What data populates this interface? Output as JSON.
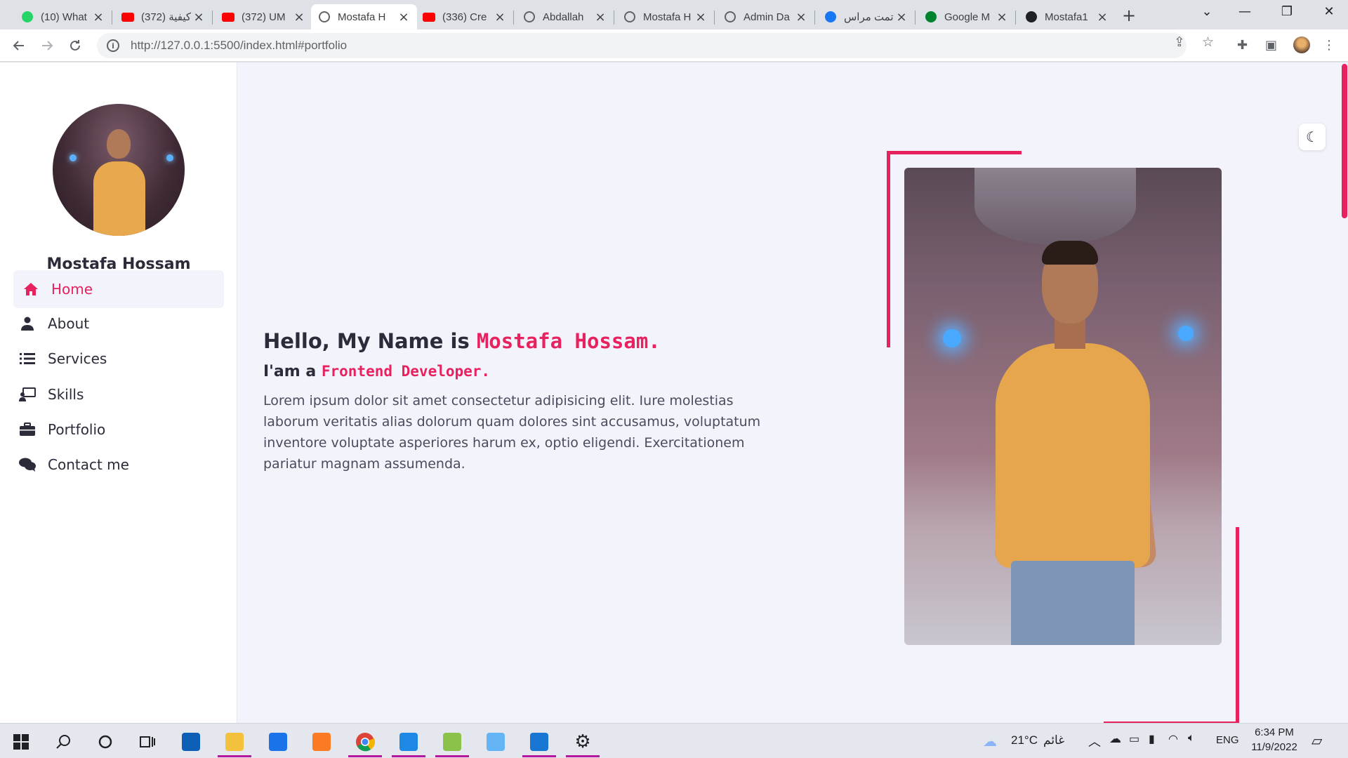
{
  "browser": {
    "tabs": [
      {
        "title": "(10) What",
        "icon": "whatsapp-icon",
        "color": "#25d366"
      },
      {
        "title": "كيفية (372)",
        "icon": "youtube-icon",
        "color": "#ff0000"
      },
      {
        "title": "(372) UM",
        "icon": "youtube-icon",
        "color": "#ff0000"
      },
      {
        "title": "Mostafa H",
        "icon": "globe-icon",
        "color": "#5f6368",
        "active": true
      },
      {
        "title": "(336) Cre",
        "icon": "youtube-icon",
        "color": "#ff0000"
      },
      {
        "title": "Abdallah",
        "icon": "globe-icon",
        "color": "#5f6368"
      },
      {
        "title": "Mostafa H",
        "icon": "globe-icon",
        "color": "#5f6368"
      },
      {
        "title": "Admin Da",
        "icon": "globe-icon",
        "color": "#5f6368"
      },
      {
        "title": "تمت مراس",
        "icon": "facebook-icon",
        "color": "#1877f2"
      },
      {
        "title": "Google M",
        "icon": "google-meet-icon",
        "color": "#00832d"
      },
      {
        "title": "Mostafa1",
        "icon": "github-icon",
        "color": "#202124"
      }
    ],
    "url": "http://127.0.0.1:5500/index.html#portfolio"
  },
  "sidebar": {
    "name": "Mostafa Hossam",
    "role": "Frontend Developer",
    "items": [
      {
        "label": "Home",
        "icon": "home-icon",
        "active": true
      },
      {
        "label": "About",
        "icon": "user-icon"
      },
      {
        "label": "Services",
        "icon": "list-icon"
      },
      {
        "label": "Skills",
        "icon": "teacher-icon"
      },
      {
        "label": "Portfolio",
        "icon": "briefcase-icon"
      },
      {
        "label": "Contact me",
        "icon": "comments-icon"
      }
    ]
  },
  "hero": {
    "greeting": "Hello, My Name is ",
    "name": "Mostafa Hossam.",
    "iam": "I'am a ",
    "role": "Frontend Developer.",
    "paragraph": "Lorem ipsum dolor sit amet consectetur adipisicing elit. Iure molestias laborum veritatis alias dolorum quam dolores sint accusamus, voluptatum inventore voluptate asperiores harum ex, optio eligendi. Exercitationem pariatur magnam assumenda."
  },
  "colors": {
    "accent": "#e8215f",
    "text": "#2b2b3a",
    "page_bg": "#f2f3fb"
  },
  "taskbar": {
    "weather_temp": "21°C",
    "weather_text": "غائم",
    "language": "ENG",
    "time": "6:34 PM",
    "date": "11/9/2022"
  }
}
